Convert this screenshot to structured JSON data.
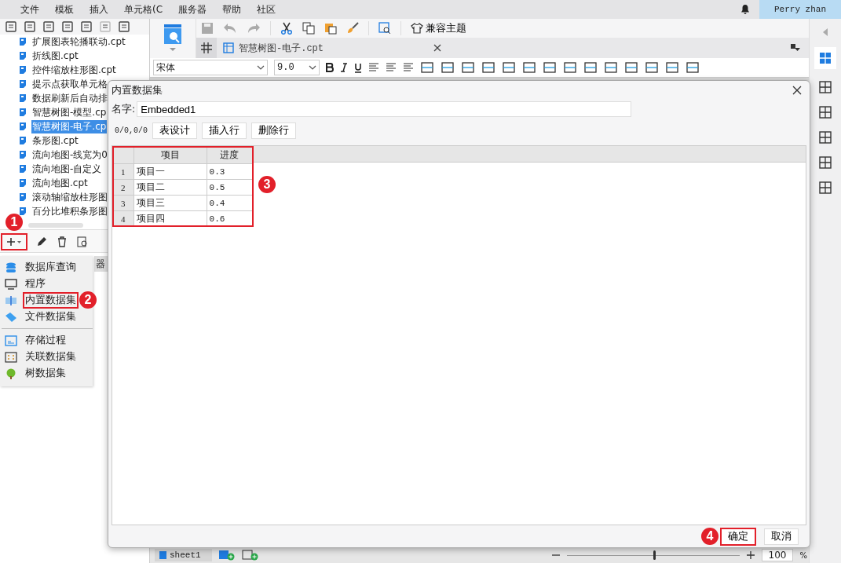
{
  "menu_bar": {
    "items": [
      "文件",
      "模板",
      "插入",
      "单元格(C",
      "服务器",
      "帮助",
      "社区"
    ],
    "user": "Perry zhan"
  },
  "file_tree": {
    "items": [
      {
        "label": "扩展图表轮播联动.cpt",
        "selected": false
      },
      {
        "label": "折线图.cpt",
        "selected": false
      },
      {
        "label": "控件缩放柱形图.cpt",
        "selected": false
      },
      {
        "label": "提示点获取单元格",
        "selected": false
      },
      {
        "label": "数据刷新后自动排",
        "selected": false
      },
      {
        "label": "智慧树图-模型.cp",
        "selected": false
      },
      {
        "label": "智慧树图-电子.cp",
        "selected": true
      },
      {
        "label": "条形图.cpt",
        "selected": false
      },
      {
        "label": "流向地图-线宽为0",
        "selected": false
      },
      {
        "label": "流向地图-自定义",
        "selected": false
      },
      {
        "label": "流向地图.cpt",
        "selected": false
      },
      {
        "label": "滚动轴缩放柱形图",
        "selected": false
      },
      {
        "label": "百分比堆积条形图",
        "selected": false
      }
    ]
  },
  "dataset_toolbar": {
    "add_button": {
      "highlighted": true,
      "badge": "1"
    }
  },
  "dataset_menu": {
    "groups": [
      [
        {
          "label": "数据库查询",
          "kind": "database",
          "highlighted": false
        },
        {
          "label": "程序",
          "kind": "program",
          "highlighted": false
        },
        {
          "label": "内置数据集",
          "kind": "embedded",
          "highlighted": true,
          "badge": "2"
        },
        {
          "label": "文件数据集",
          "kind": "file",
          "highlighted": false
        }
      ],
      [
        {
          "label": "存储过程",
          "kind": "procedure",
          "highlighted": false
        },
        {
          "label": "关联数据集",
          "kind": "relation",
          "highlighted": false
        },
        {
          "label": "树数据集",
          "kind": "tree",
          "highlighted": false
        }
      ]
    ]
  },
  "server_tab": "器",
  "editor": {
    "theme_button": "兼容主题",
    "tab": "智慧树图-电子.cpt",
    "font": "宋体",
    "font_size": "9.0"
  },
  "dialog": {
    "title": "内置数据集",
    "name_label": "名字:",
    "name_value": "Embedded1",
    "position": "0/0,0/0",
    "buttons": [
      "表设计",
      "插入行",
      "删除行"
    ],
    "table": {
      "highlighted": true,
      "badge": "3",
      "columns": [
        "项目",
        "进度"
      ],
      "rows": [
        {
          "index": "1",
          "cells": [
            "项目一",
            "0.3"
          ]
        },
        {
          "index": "2",
          "cells": [
            "项目二",
            "0.5"
          ]
        },
        {
          "index": "3",
          "cells": [
            "项目三",
            "0.4"
          ]
        },
        {
          "index": "4",
          "cells": [
            "项目四",
            "0.6"
          ]
        }
      ]
    },
    "ok_button": {
      "label": "确定",
      "highlighted": true,
      "badge": "4"
    },
    "cancel_button": "取消"
  },
  "status_bar": {
    "sheet": "sheet1",
    "zoom": {
      "level": 0.5,
      "value": "100",
      "unit": "%"
    }
  }
}
